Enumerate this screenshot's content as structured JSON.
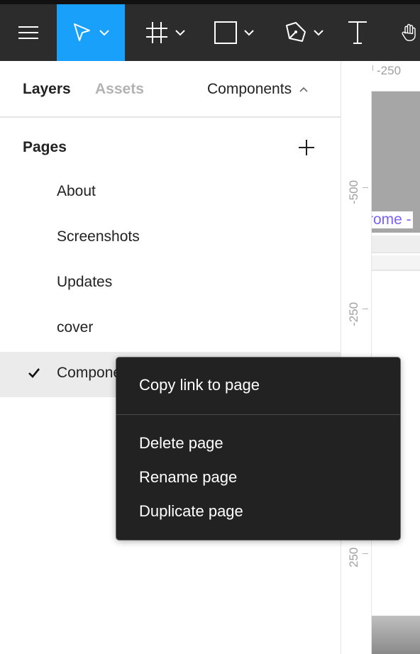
{
  "toolbar": {
    "accent_color": "#18a0fb",
    "background_color": "#2c2c2c",
    "tools": [
      {
        "name": "main-menu",
        "icon": "hamburger-icon",
        "active": false
      },
      {
        "name": "move-tool",
        "icon": "cursor-arrow-icon",
        "active": true
      },
      {
        "name": "frame-tool",
        "icon": "frame-hash-icon",
        "active": false
      },
      {
        "name": "shape-tool",
        "icon": "rectangle-icon",
        "active": false
      },
      {
        "name": "pen-tool",
        "icon": "pen-nib-icon",
        "active": false
      },
      {
        "name": "text-tool",
        "icon": "text-t-icon",
        "active": false
      },
      {
        "name": "hand-tool",
        "icon": "hand-icon",
        "active": false
      }
    ]
  },
  "sidebar": {
    "tabs": {
      "layers": "Layers",
      "assets": "Assets"
    },
    "page_select": "Components",
    "pages_header": "Pages",
    "pages": [
      {
        "label": "About",
        "selected": false
      },
      {
        "label": "Screenshots",
        "selected": false
      },
      {
        "label": "Updates",
        "selected": false
      },
      {
        "label": "cover",
        "selected": false
      },
      {
        "label": "Components",
        "selected": true
      }
    ]
  },
  "canvas": {
    "ruler_top": [
      "-250"
    ],
    "ruler_left": [
      "-500",
      "-250",
      "250"
    ],
    "frame_label": "rome -",
    "frame_label_color": "#7b61ff"
  },
  "context_menu": {
    "items": [
      {
        "label": "Copy link to page"
      },
      {
        "label": "Delete page"
      },
      {
        "label": "Rename page"
      },
      {
        "label": "Duplicate page"
      }
    ]
  }
}
